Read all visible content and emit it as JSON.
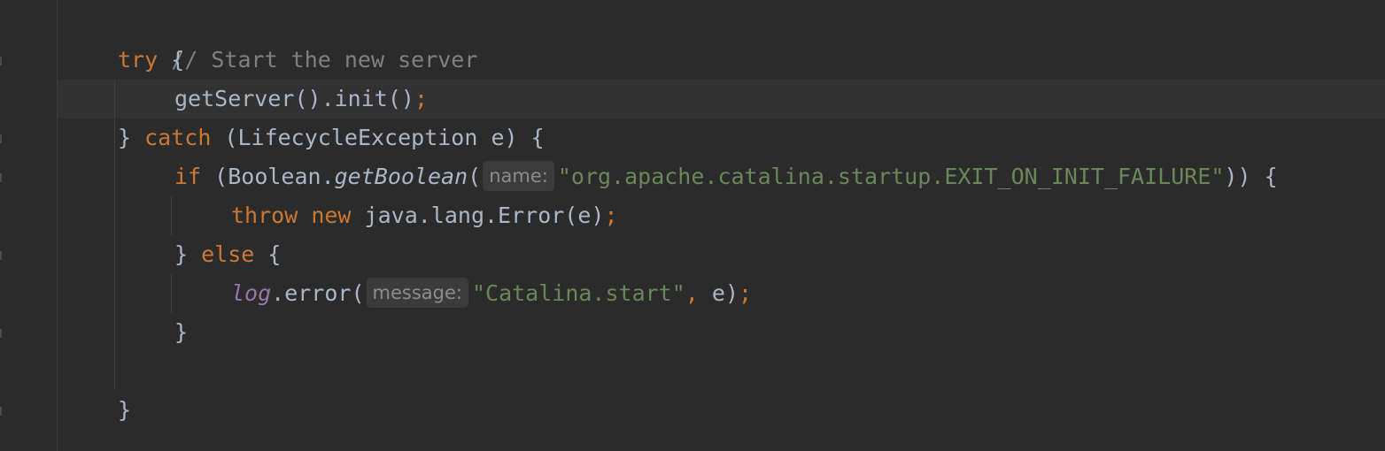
{
  "theme": {
    "background": "#2b2b2b",
    "keyword": "#cc7832",
    "comment": "#808080",
    "string": "#6a8759",
    "text": "#a9b7c6",
    "field": "#9876aa",
    "hint_bg": "#3b3b3b"
  },
  "code": {
    "l1": {
      "comment": "// Start the new server"
    },
    "l2": {
      "kw_try": "try",
      "brace": " {"
    },
    "l3": {
      "call": "getServer().init()",
      "semi": ";"
    },
    "l4": {
      "close": "} ",
      "kw_catch": "catch",
      "rest": " (LifecycleException e) {"
    },
    "l5": {
      "kw_if": "if",
      "pre": " (Boolean.",
      "method": "getBoolean",
      "paren": "(",
      "hint": "name:",
      "string": "\"org.apache.catalina.startup.EXIT_ON_INIT_FAILURE\"",
      "tail": ")) {"
    },
    "l6": {
      "kw_throw": "throw",
      "sp": " ",
      "kw_new": "new",
      "rest": " java.lang.Error(e)",
      "semi": ";"
    },
    "l7": {
      "close": "} ",
      "kw_else": "else",
      "brace": " {"
    },
    "l8": {
      "field": "log",
      "call": ".error(",
      "hint": "message:",
      "string": "\"Catalina.start\"",
      "comma": ",",
      "rest": " e)",
      "semi": ";"
    },
    "l9": {
      "brace": "}"
    },
    "l11": {
      "brace": "}"
    }
  }
}
